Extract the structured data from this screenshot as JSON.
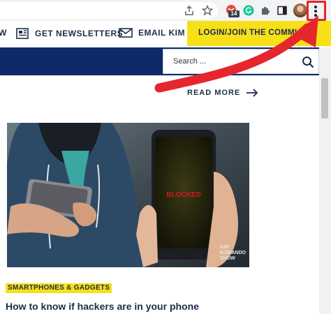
{
  "browser": {
    "extension_badge": "14",
    "icons": [
      "share-icon",
      "bookmark-star-icon",
      "gmail-extension-icon",
      "grammarly-icon",
      "puzzle-icon",
      "side-panel-icon",
      "profile-avatar",
      "kebab-menu-icon"
    ]
  },
  "nav": {
    "partial_item": "W",
    "newsletters": "GET NEWSLETTERS",
    "email": "EMAIL KIM",
    "login": "LOGIN/JOIN THE COMMUNI"
  },
  "search": {
    "placeholder": "Search ..."
  },
  "read_more": "READ MORE",
  "article": {
    "category": "SMARTPHONES & GADGETS",
    "title": "How to know if hackers are in your phone",
    "image_text": {
      "blocked": "BLOCKED",
      "watermark_line1": "KIM",
      "watermark_line2": "KOMANDO",
      "watermark_line3": "SHOW"
    }
  },
  "colors": {
    "navy": "#0e2a6b",
    "accent_yellow": "#f7e018",
    "annotation_red": "#e5262c",
    "text_dark": "#1c2e4a"
  }
}
